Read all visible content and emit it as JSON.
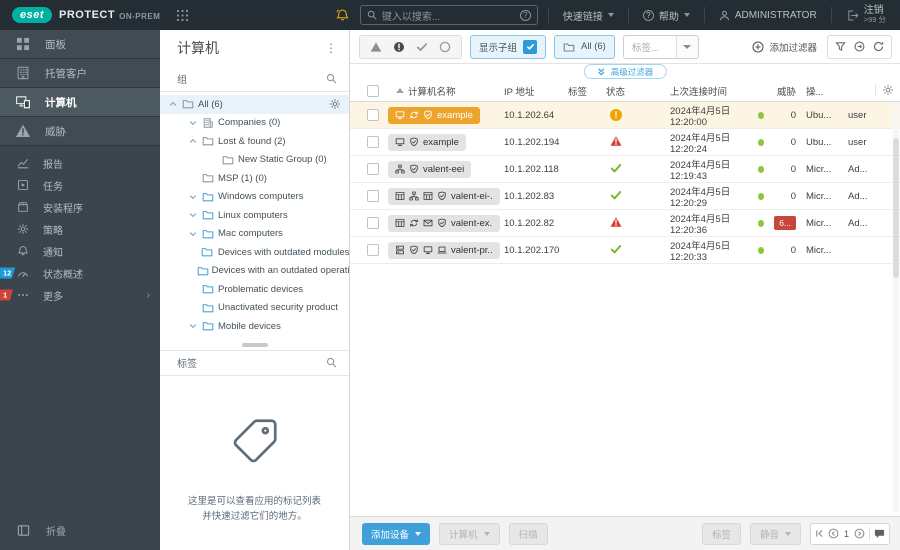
{
  "topbar": {
    "logo": "eset",
    "product": "PROTECT",
    "edition": "ON-PREM",
    "search_placeholder": "键入以搜索...",
    "quick_links_label": "快速链接",
    "help_label": "帮助",
    "user_label": "ADMINISTRATOR",
    "logout_label": "注销",
    "logout_sub": ">99 分"
  },
  "sidebar": {
    "items": [
      {
        "label": "面板",
        "icon": "dashboard-icon",
        "group": "top"
      },
      {
        "label": "托管客户",
        "icon": "building-icon",
        "group": "top"
      },
      {
        "label": "计算机",
        "icon": "computers-icon",
        "group": "top",
        "selected": true
      },
      {
        "label": "威胁",
        "icon": "threat-warning-icon",
        "group": "top"
      },
      {
        "label": "报告",
        "icon": "reports-icon",
        "group": "sub"
      },
      {
        "label": "任务",
        "icon": "tasks-icon",
        "group": "sub"
      },
      {
        "label": "安装程序",
        "icon": "installers-icon",
        "group": "sub"
      },
      {
        "label": "策略",
        "icon": "policies-icon",
        "group": "sub"
      },
      {
        "label": "通知",
        "icon": "notifications-icon",
        "group": "sub"
      },
      {
        "label": "状态概述",
        "icon": "status-overview-icon",
        "group": "sub",
        "badge": "12",
        "badge_color": "#1d9bd7"
      },
      {
        "label": "更多",
        "icon": "more-icon",
        "group": "sub",
        "badge": "1",
        "badge_color": "#d04437",
        "chevron": true
      }
    ],
    "collapse_label": "折叠"
  },
  "groups_panel": {
    "title": "计算机",
    "groups_header": "组",
    "tags_header": "标签",
    "tags_empty_text": "这里是可以查看应用的标记列表并快速过滤它们的地方。",
    "tree": [
      {
        "label": "All (6)",
        "level": 0,
        "caret": "up",
        "icon": "folder-gray-icon",
        "gear": true,
        "selected": true
      },
      {
        "label": "Companies (0)",
        "level": 1,
        "caret": "down",
        "icon": "company-icon"
      },
      {
        "label": "Lost & found (2)",
        "level": 1,
        "caret": "up",
        "icon": "folder-gray-icon"
      },
      {
        "label": "New Static Group (0)",
        "level": 2,
        "caret": null,
        "icon": "folder-gray-icon"
      },
      {
        "label": "MSP (1) (0)",
        "level": 1,
        "caret": null,
        "icon": "folder-gray-icon"
      },
      {
        "label": "Windows computers",
        "level": 1,
        "caret": "down",
        "icon": "folder-blue-icon"
      },
      {
        "label": "Linux computers",
        "level": 1,
        "caret": "down",
        "icon": "folder-blue-icon"
      },
      {
        "label": "Mac computers",
        "level": 1,
        "caret": "down",
        "icon": "folder-blue-icon"
      },
      {
        "label": "Devices with outdated modules",
        "level": 1,
        "caret": null,
        "icon": "folder-blue-icon"
      },
      {
        "label": "Devices with an outdated operating system",
        "level": 1,
        "caret": null,
        "icon": "folder-blue-icon"
      },
      {
        "label": "Problematic devices",
        "level": 1,
        "caret": null,
        "icon": "folder-blue-icon"
      },
      {
        "label": "Unactivated security product",
        "level": 1,
        "caret": null,
        "icon": "folder-blue-icon"
      },
      {
        "label": "Mobile devices",
        "level": 1,
        "caret": "down",
        "icon": "folder-blue-icon"
      }
    ]
  },
  "toolbar": {
    "status_filter_icons": [
      "warning-triangle-icon",
      "alert-circle-icon",
      "check-icon",
      "circle-icon"
    ],
    "show_subgroups_label": "显示子组",
    "show_subgroups_checked": true,
    "group_filter_label": "All (6)",
    "tags_filter_placeholder": "标签...",
    "add_filter_label": "添加过滤器",
    "advanced_filters_label": "高级过滤器"
  },
  "table": {
    "columns": [
      "计算机名称",
      "IP 地址",
      "标签",
      "状态",
      "上次连接时间",
      "威胁",
      "操...",
      ""
    ],
    "rows": [
      {
        "name": "example",
        "pill": "orange",
        "icons": [
          "monitor-icon",
          "sync-icon",
          "shield-check-icon"
        ],
        "ip": "10.1.202.64",
        "status": "warning",
        "last_connected": "2024年4月5日 12:20:00",
        "threats": "0",
        "threat_badge": false,
        "os": "Ubu...",
        "user": "user",
        "highlighted": true
      },
      {
        "name": "example",
        "pill": "gray",
        "icons": [
          "monitor-icon",
          "shield-check-icon"
        ],
        "ip": "10.1.202.194",
        "status": "alert",
        "last_connected": "2024年4月5日 12:20:24",
        "threats": "0",
        "threat_badge": false,
        "os": "Ubu...",
        "user": "user",
        "highlighted": false
      },
      {
        "name": "valent-eei",
        "pill": "gray",
        "icons": [
          "network-icon",
          "shield-check-icon"
        ],
        "ip": "10.1.202.118",
        "status": "ok",
        "last_connected": "2024年4月5日 12:19:43",
        "threats": "0",
        "threat_badge": false,
        "os": "Micr...",
        "user": "Ad...",
        "highlighted": false
      },
      {
        "name": "valent-ei-...",
        "pill": "gray",
        "icons": [
          "table-icon",
          "network-icon",
          "table-icon",
          "shield-check-icon"
        ],
        "ip": "10.1.202.83",
        "status": "ok",
        "last_connected": "2024年4月5日 12:20:29",
        "threats": "0",
        "threat_badge": false,
        "os": "Micr...",
        "user": "Ad...",
        "highlighted": false
      },
      {
        "name": "valent-ex...",
        "pill": "gray",
        "icons": [
          "table-icon",
          "sync-icon",
          "mail-icon",
          "shield-check-icon"
        ],
        "ip": "10.1.202.82",
        "status": "alert",
        "last_connected": "2024年4月5日 12:20:36",
        "threats": "6...",
        "threat_badge": true,
        "os": "Micr...",
        "user": "Ad...",
        "highlighted": false
      },
      {
        "name": "valent-pr...",
        "pill": "gray",
        "icons": [
          "server-icon",
          "shield-check-icon",
          "monitor-icon",
          "laptop-icon"
        ],
        "ip": "10.1.202.170",
        "status": "ok",
        "last_connected": "2024年4月5日 12:20:33",
        "threats": "0",
        "threat_badge": false,
        "os": "Micr...",
        "user": "",
        "highlighted": false
      }
    ]
  },
  "bottombar": {
    "add_device_label": "添加设备",
    "computer_label": "计算机",
    "scan_label": "扫描",
    "tags_label": "标签",
    "mute_label": "静音",
    "page_number": "1"
  },
  "colors": {
    "brand_teal": "#00b0a3",
    "accent_blue": "#2b9cd8",
    "warning_orange": "#f1a500",
    "alert_red": "#d63c2e",
    "ok_green": "#76b82a",
    "selected_row_orange": "#eda42c"
  }
}
